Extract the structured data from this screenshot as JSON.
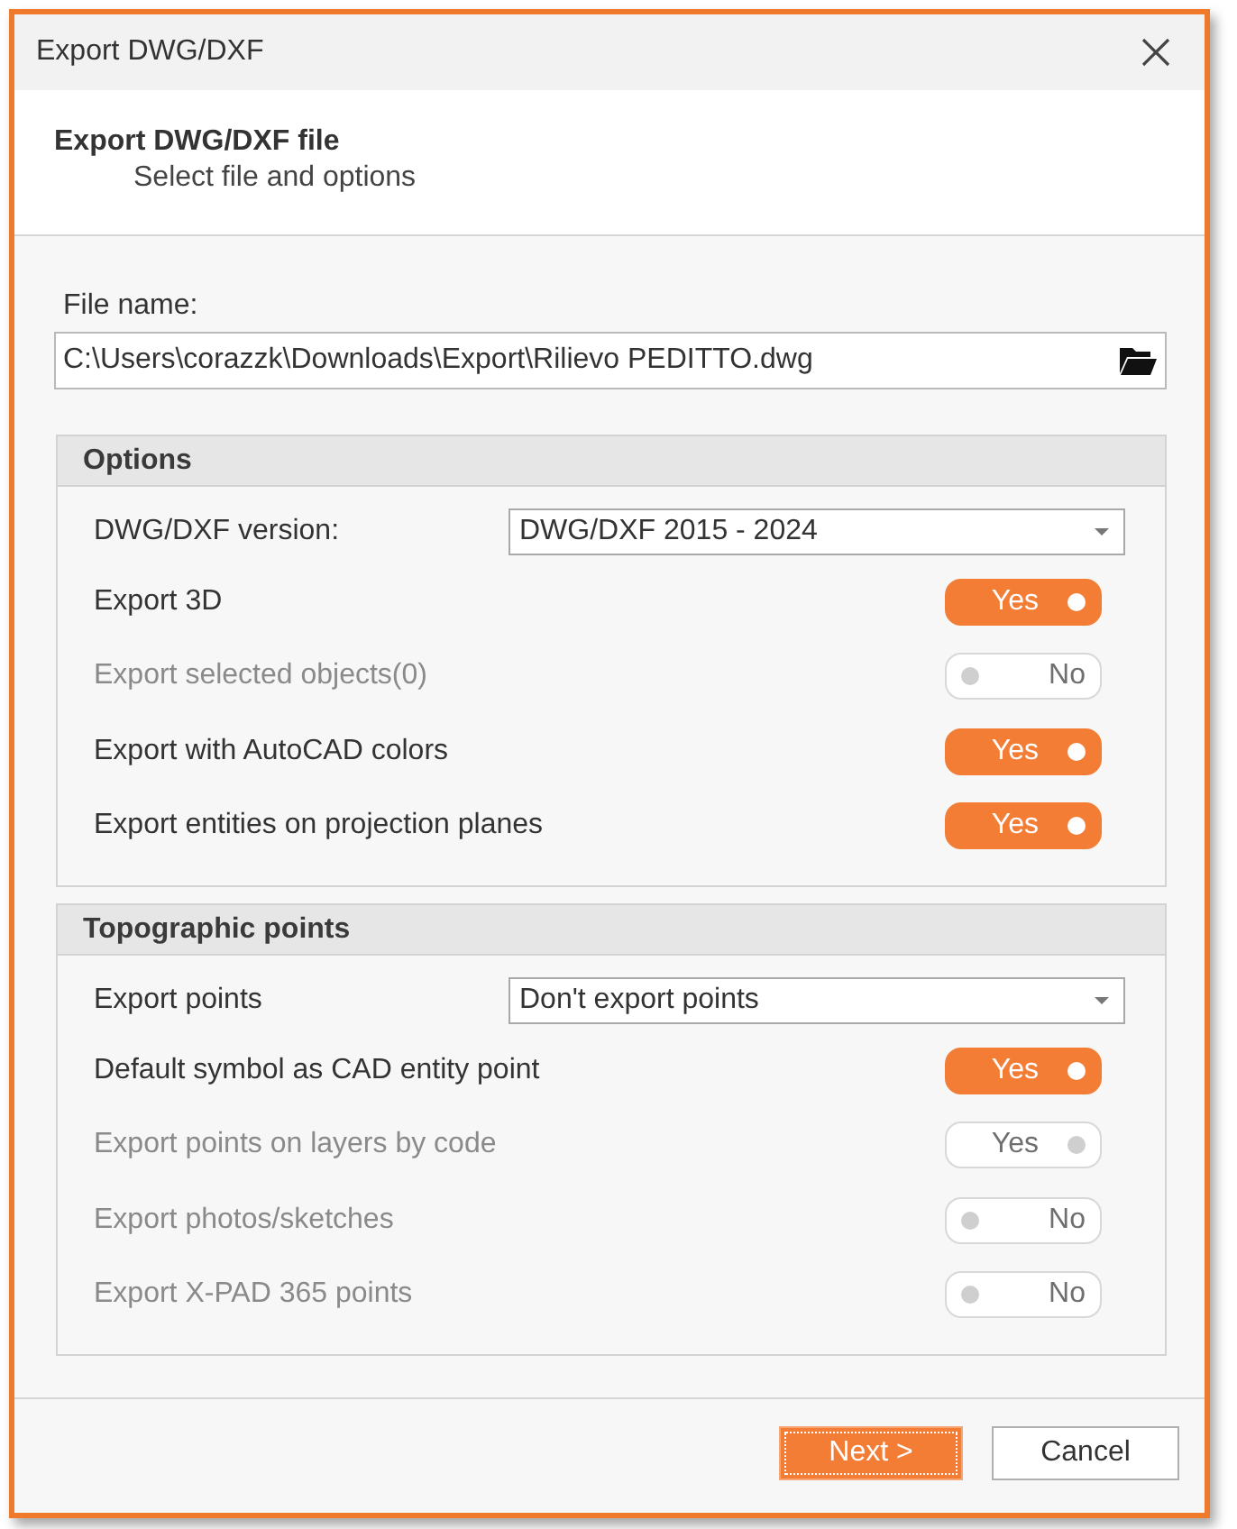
{
  "window": {
    "title": "Export DWG/DXF"
  },
  "header": {
    "title": "Export DWG/DXF file",
    "subtitle": "Select file and options"
  },
  "file": {
    "label": "File name:",
    "value": "C:\\Users\\corazzk\\Downloads\\Export\\Rilievo PEDITTO.dwg"
  },
  "groups": [
    {
      "title": "Options",
      "rows": [
        {
          "kind": "select",
          "label": "DWG/DXF version:",
          "value": "DWG/DXF 2015 - 2024"
        },
        {
          "kind": "toggle",
          "label": "Export 3D",
          "on": true,
          "disabled": false,
          "text": "Yes"
        },
        {
          "kind": "toggle",
          "label": "Export selected objects(0)",
          "on": false,
          "disabled": true,
          "text": "No"
        },
        {
          "kind": "toggle",
          "label": "Export with AutoCAD colors",
          "on": true,
          "disabled": false,
          "text": "Yes"
        },
        {
          "kind": "toggle",
          "label": "Export entities on projection planes",
          "on": true,
          "disabled": false,
          "text": "Yes"
        }
      ]
    },
    {
      "title": "Topographic points",
      "rows": [
        {
          "kind": "select",
          "label": "Export points",
          "value": "Don't export points"
        },
        {
          "kind": "toggle",
          "label": "Default symbol as CAD entity point",
          "on": true,
          "disabled": false,
          "text": "Yes"
        },
        {
          "kind": "toggle",
          "label": "Export points on layers by code",
          "on": true,
          "disabled": true,
          "text": "Yes"
        },
        {
          "kind": "toggle",
          "label": "Export photos/sketches",
          "on": false,
          "disabled": true,
          "text": "No"
        },
        {
          "kind": "toggle",
          "label": "Export X-PAD 365 points",
          "on": false,
          "disabled": true,
          "text": "No"
        }
      ]
    }
  ],
  "buttons": [
    {
      "label": "Next >",
      "default": true
    },
    {
      "label": "Cancel",
      "default": false
    }
  ]
}
